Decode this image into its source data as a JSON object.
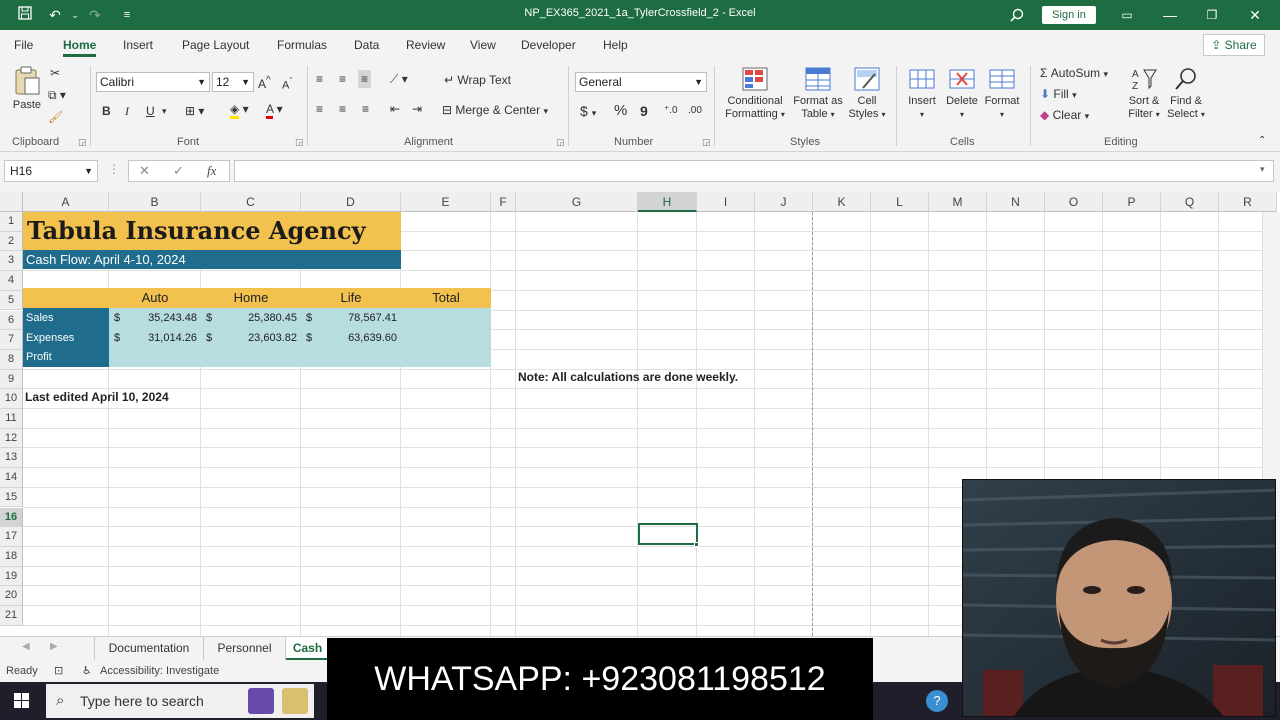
{
  "window": {
    "title": "NP_EX365_2021_1a_TylerCrossfield_2  -  Excel",
    "sign_in": "Sign in"
  },
  "tabs": [
    "File",
    "Home",
    "Insert",
    "Page Layout",
    "Formulas",
    "Data",
    "Review",
    "View",
    "Developer",
    "Help"
  ],
  "active_tab": "Home",
  "share_label": "Share",
  "ribbon": {
    "clipboard": {
      "paste": "Paste",
      "label": "Clipboard"
    },
    "font": {
      "name": "Calibri",
      "size": "12",
      "label": "Font",
      "bold": "B",
      "italic": "I",
      "underline": "U"
    },
    "alignment": {
      "wrap": "Wrap Text",
      "merge": "Merge & Center",
      "label": "Alignment"
    },
    "number": {
      "format": "General",
      "currency": "$",
      "percent": "%",
      "comma": "9",
      "label": "Number"
    },
    "styles": {
      "conditional": "Conditional",
      "conditional2": "Formatting",
      "format_table": "Format as",
      "format_table2": "Table",
      "cell_styles": "Cell",
      "cell_styles2": "Styles",
      "label": "Styles"
    },
    "cells": {
      "insert": "Insert",
      "delete": "Delete",
      "format": "Format",
      "label": "Cells"
    },
    "editing": {
      "autosum": "AutoSum",
      "fill": "Fill",
      "clear": "Clear",
      "sort": "Sort &",
      "sort2": "Filter",
      "find": "Find &",
      "find2": "Select",
      "label": "Editing"
    }
  },
  "formula_bar": {
    "name_box": "H16",
    "formula": ""
  },
  "columns": [
    "A",
    "B",
    "C",
    "D",
    "E",
    "F",
    "G",
    "H",
    "I",
    "J",
    "K",
    "L",
    "M",
    "N",
    "O",
    "P",
    "Q",
    "R"
  ],
  "rows": [
    "1",
    "2",
    "3",
    "4",
    "5",
    "6",
    "7",
    "8",
    "9",
    "10",
    "11",
    "12",
    "13",
    "14",
    "15",
    "16",
    "17",
    "18",
    "19",
    "20",
    "21"
  ],
  "selected_cell": "H16",
  "sheet": {
    "title": "Tabula Insurance Agency",
    "subtitle": "Cash Flow: April 4-10, 2024",
    "headers": [
      "Auto",
      "Home",
      "Life",
      "Total"
    ],
    "row_labels": [
      "Sales",
      "Expenses",
      "Profit"
    ],
    "sales": [
      "35,243.48",
      "25,380.45",
      "78,567.41"
    ],
    "expenses": [
      "31,014.26",
      "23,603.82",
      "63,639.60"
    ],
    "currency": "$",
    "last_edited": "Last edited April 10, 2024",
    "note": "Note: All calculations are done weekly."
  },
  "sheet_tabs": [
    "Documentation",
    "Personnel",
    "Cash"
  ],
  "active_sheet": "Cash",
  "status": {
    "ready": "Ready",
    "accessibility": "Accessibility: Investigate"
  },
  "taskbar": {
    "search": "Type here to search"
  },
  "overlay_text": "WHATSAPP: +923081198512",
  "colors": {
    "excel_green": "#1e6c41",
    "title_gold": "#f2c14e",
    "subtitle_teal": "#1f6c8c",
    "data_fill": "#b7dde1",
    "header_gold": "#f2c14e"
  }
}
